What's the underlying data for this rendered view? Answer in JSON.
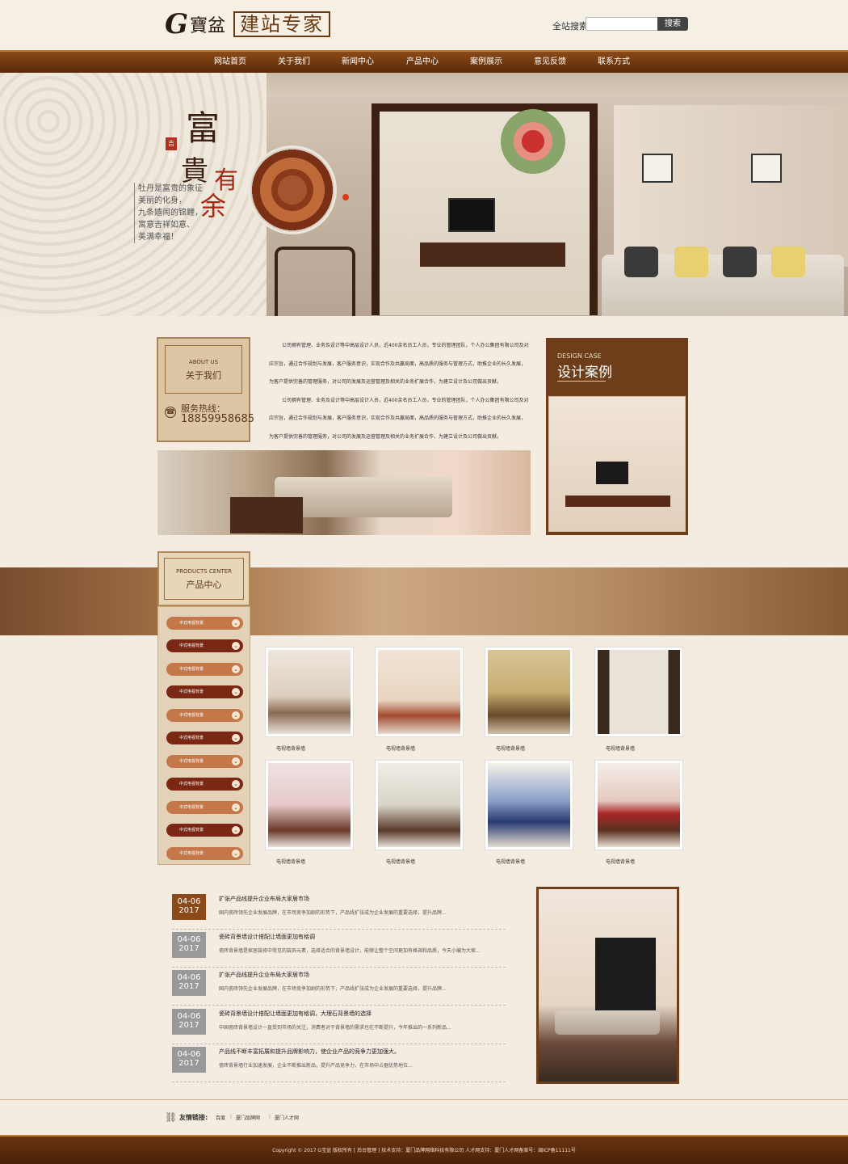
{
  "header": {
    "logo_g": "G",
    "logo_cn": "寶盆",
    "logo_box": "建站专家",
    "search_label": "全站搜索:",
    "search_placeholder": "",
    "search_button": "搜索"
  },
  "nav": {
    "items": [
      "网站首页",
      "关于我们",
      "新闻中心",
      "产品中心",
      "案例展示",
      "意见反馈",
      "联系方式"
    ]
  },
  "banner": {
    "title_1": "富",
    "title_2": "貴",
    "title_3": "有",
    "title_4": "余",
    "seal": "吉祥",
    "verse": [
      "牡丹是富贵的象征",
      "美丽的化身，",
      "九条嬉闹的锦鲤，",
      "寓意吉祥如意、",
      "美满幸福！"
    ]
  },
  "about": {
    "tag_en": "ABOUT US",
    "tag_cn": "关于我们",
    "hotline_label": "服务热线：",
    "hotline_number": "18859958685",
    "paragraphs": [
      "公司拥有管理、业务及设计等中高层设计人员，近400余名员工人员，专业的管理团队，个人办公集团有限公司及对应宗旨，通过合作规划与发展，客户服务意识，实现合作及共赢局面，高品质的服务与管理方式，助推企业的长久发展，为客户提供完善的管理服务，对公司的发展及运营管理及相关的业务扩展合作，为建立设计及公司做出贡献。",
      "公司拥有管理、业务及设计等中高层设计人员，近400余名员工人员，专业的管理团队，个人办公集团有限公司及对应宗旨，通过合作规划与发展，客户服务意识，实现合作及共赢局面，高品质的服务与管理方式，助推企业的长久发展，为客户提供完善的管理服务，对公司的发展及运营管理及相关的业务扩展合作，为建立设计及公司做出贡献。"
    ]
  },
  "design_case": {
    "en": "DESIGN CASE",
    "cn": "设计案例"
  },
  "products": {
    "tag_en": "PRODUCTS CENTER",
    "tag_cn": "产品中心",
    "side_items": [
      "中式电视背景",
      "中式电视背景",
      "中式电视背景",
      "中式电视背景",
      "中式电视背景",
      "中式电视背景",
      "中式电视背景",
      "中式电视背景",
      "中式电视背景",
      "中式电视背景",
      "中式电视背景"
    ],
    "item_labels": [
      "电视墙背景墙",
      "电视墙背景墙",
      "电视墙背景墙",
      "电视墙背景墙",
      "电视墙背景墙",
      "电视墙背景墙",
      "电视墙背景墙",
      "电视墙背景墙"
    ]
  },
  "news": {
    "items": [
      {
        "md": "04-06",
        "year": "2017",
        "title": "扩张产品线提升企业布局大家居市场",
        "desc": "国内瓷砖领先企业发展品牌，在市场竞争加剧的形势下，产品线扩张成为企业发展的重要选择，提升品牌..."
      },
      {
        "md": "04-06",
        "year": "2017",
        "title": "瓷砖背景墙设计搭配让墙面更加有格调",
        "desc": "瓷砖背景墙是家居装修中常见的装饰元素，选择适合的背景墙设计，能够让整个空间更加有格调和品质，今天小编为大家..."
      },
      {
        "md": "04-06",
        "year": "2017",
        "title": "扩张产品线提升企业布局大家居市场",
        "desc": "国内瓷砖领先企业发展品牌，在市场竞争加剧的形势下，产品线扩张成为企业发展的重要选择，提升品牌..."
      },
      {
        "md": "04-06",
        "year": "2017",
        "title": "瓷砖背景墙设计搭配让墙面更加有格调，大理石背景墙的选择",
        "desc": "中国瓷砖背景墙设计一直受到市场的关注，消费者对于背景墙的需求也在不断提升，今年推出的一系列新品..."
      },
      {
        "md": "04-06",
        "year": "2017",
        "title": "产品线不断丰富拓展和提升品牌影响力，使企业产品的竞争力更加强大。",
        "desc": "瓷砖背景墙行业加速发展，企业不断推出新品，提升产品竞争力，在市场中占据优势地位..."
      }
    ]
  },
  "footer": {
    "links_label": "友情链接:",
    "links": [
      "百度",
      "厦门品牌网",
      "厦门人才网"
    ],
    "copyright": "Copyright © 2017 G宝盆 版权所有 [ 后台管理 ] 技术支持：厦门品牌网络科技有限公司 人才网支持：厦门人才网备案号：闽ICP备11111号"
  },
  "colors": {
    "brand_brown": "#6e3e1a",
    "nav_brown": "#7a3e12",
    "bg_cream": "#f4ece0",
    "date_brown": "#8a4a1a",
    "date_gray": "#999999"
  }
}
